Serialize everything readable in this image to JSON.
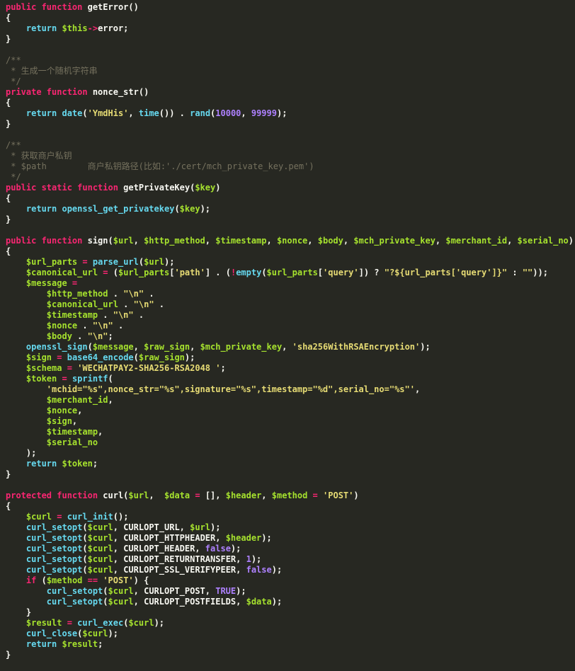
{
  "colors": {
    "background": "#272822",
    "keyword": "#f92672",
    "function": "#66d9ef",
    "variable": "#a6e22e",
    "string": "#e6db74",
    "number": "#ae81ff",
    "comment": "#75715e",
    "default": "#f8f8f2"
  },
  "code": {
    "lines": [
      [
        [
          "k",
          "public function "
        ],
        [
          "d",
          "getError()"
        ]
      ],
      [
        [
          "d",
          "{"
        ]
      ],
      [
        [
          "d",
          "    "
        ],
        [
          "f",
          "return "
        ],
        [
          "v",
          "$this"
        ],
        [
          "o",
          "->"
        ],
        [
          "d",
          "error;"
        ]
      ],
      [
        [
          "d",
          "}"
        ]
      ],
      [
        [
          "d",
          ""
        ]
      ],
      [
        [
          "c",
          "/**"
        ]
      ],
      [
        [
          "c",
          " * 生成一个随机字符串"
        ]
      ],
      [
        [
          "c",
          " */"
        ]
      ],
      [
        [
          "k",
          "private function "
        ],
        [
          "d",
          "nonce_str()"
        ]
      ],
      [
        [
          "d",
          "{"
        ]
      ],
      [
        [
          "d",
          "    "
        ],
        [
          "f",
          "return "
        ],
        [
          "f",
          "date"
        ],
        [
          "d",
          "("
        ],
        [
          "s",
          "'YmdHis'"
        ],
        [
          "d",
          ", "
        ],
        [
          "f",
          "time"
        ],
        [
          "d",
          "()) . "
        ],
        [
          "f",
          "rand"
        ],
        [
          "d",
          "("
        ],
        [
          "n",
          "10000"
        ],
        [
          "d",
          ", "
        ],
        [
          "n",
          "99999"
        ],
        [
          "d",
          ");"
        ]
      ],
      [
        [
          "d",
          "}"
        ]
      ],
      [
        [
          "d",
          ""
        ]
      ],
      [
        [
          "c",
          "/**"
        ]
      ],
      [
        [
          "c",
          " * 获取商户私钥"
        ]
      ],
      [
        [
          "c",
          " * $path        商户私钥路径(比如:'./cert/mch_private_key.pem')"
        ]
      ],
      [
        [
          "c",
          " */"
        ]
      ],
      [
        [
          "k",
          "public static function "
        ],
        [
          "d",
          "getPrivateKey("
        ],
        [
          "v",
          "$key"
        ],
        [
          "d",
          ")"
        ]
      ],
      [
        [
          "d",
          "{"
        ]
      ],
      [
        [
          "d",
          "    "
        ],
        [
          "f",
          "return "
        ],
        [
          "f",
          "openssl_get_privatekey"
        ],
        [
          "d",
          "("
        ],
        [
          "v",
          "$key"
        ],
        [
          "d",
          ");"
        ]
      ],
      [
        [
          "d",
          "}"
        ]
      ],
      [
        [
          "d",
          ""
        ]
      ],
      [
        [
          "k",
          "public function "
        ],
        [
          "d",
          "sign("
        ],
        [
          "v",
          "$url"
        ],
        [
          "d",
          ", "
        ],
        [
          "v",
          "$http_method"
        ],
        [
          "d",
          ", "
        ],
        [
          "v",
          "$timestamp"
        ],
        [
          "d",
          ", "
        ],
        [
          "v",
          "$nonce"
        ],
        [
          "d",
          ", "
        ],
        [
          "v",
          "$body"
        ],
        [
          "d",
          ", "
        ],
        [
          "v",
          "$mch_private_key"
        ],
        [
          "d",
          ", "
        ],
        [
          "v",
          "$merchant_id"
        ],
        [
          "d",
          ", "
        ],
        [
          "v",
          "$serial_no"
        ],
        [
          "d",
          ")"
        ]
      ],
      [
        [
          "d",
          "{"
        ]
      ],
      [
        [
          "d",
          "    "
        ],
        [
          "v",
          "$url_parts"
        ],
        [
          "o",
          " = "
        ],
        [
          "f",
          "parse_url"
        ],
        [
          "d",
          "("
        ],
        [
          "v",
          "$url"
        ],
        [
          "d",
          ");"
        ]
      ],
      [
        [
          "d",
          "    "
        ],
        [
          "v",
          "$canonical_url"
        ],
        [
          "o",
          " = "
        ],
        [
          "d",
          "("
        ],
        [
          "v",
          "$url_parts"
        ],
        [
          "d",
          "["
        ],
        [
          "s",
          "'path'"
        ],
        [
          "d",
          "] . ("
        ],
        [
          "o",
          "!"
        ],
        [
          "f",
          "empty"
        ],
        [
          "d",
          "("
        ],
        [
          "v",
          "$url_parts"
        ],
        [
          "d",
          "["
        ],
        [
          "s",
          "'query'"
        ],
        [
          "d",
          "]) ? "
        ],
        [
          "s",
          "\"?${url_parts['query']}\""
        ],
        [
          "d",
          " : "
        ],
        [
          "s",
          "\"\""
        ],
        [
          "d",
          "));"
        ]
      ],
      [
        [
          "d",
          "    "
        ],
        [
          "v",
          "$message"
        ],
        [
          "o",
          " ="
        ]
      ],
      [
        [
          "d",
          "        "
        ],
        [
          "v",
          "$http_method"
        ],
        [
          "d",
          " . "
        ],
        [
          "s",
          "\"\\n\""
        ],
        [
          "d",
          " ."
        ]
      ],
      [
        [
          "d",
          "        "
        ],
        [
          "v",
          "$canonical_url"
        ],
        [
          "d",
          " . "
        ],
        [
          "s",
          "\"\\n\""
        ],
        [
          "d",
          " ."
        ]
      ],
      [
        [
          "d",
          "        "
        ],
        [
          "v",
          "$timestamp"
        ],
        [
          "d",
          " . "
        ],
        [
          "s",
          "\"\\n\""
        ],
        [
          "d",
          " ."
        ]
      ],
      [
        [
          "d",
          "        "
        ],
        [
          "v",
          "$nonce"
        ],
        [
          "d",
          " . "
        ],
        [
          "s",
          "\"\\n\""
        ],
        [
          "d",
          " ."
        ]
      ],
      [
        [
          "d",
          "        "
        ],
        [
          "v",
          "$body"
        ],
        [
          "d",
          " . "
        ],
        [
          "s",
          "\"\\n\""
        ],
        [
          "d",
          ";"
        ]
      ],
      [
        [
          "d",
          "    "
        ],
        [
          "f",
          "openssl_sign"
        ],
        [
          "d",
          "("
        ],
        [
          "v",
          "$message"
        ],
        [
          "d",
          ", "
        ],
        [
          "v",
          "$raw_sign"
        ],
        [
          "d",
          ", "
        ],
        [
          "v",
          "$mch_private_key"
        ],
        [
          "d",
          ", "
        ],
        [
          "s",
          "'sha256WithRSAEncryption'"
        ],
        [
          "d",
          ");"
        ]
      ],
      [
        [
          "d",
          "    "
        ],
        [
          "v",
          "$sign"
        ],
        [
          "o",
          " = "
        ],
        [
          "f",
          "base64_encode"
        ],
        [
          "d",
          "("
        ],
        [
          "v",
          "$raw_sign"
        ],
        [
          "d",
          ");"
        ]
      ],
      [
        [
          "d",
          "    "
        ],
        [
          "v",
          "$schema"
        ],
        [
          "o",
          " = "
        ],
        [
          "s",
          "'WECHATPAY2-SHA256-RSA2048 '"
        ],
        [
          "d",
          ";"
        ]
      ],
      [
        [
          "d",
          "    "
        ],
        [
          "v",
          "$token"
        ],
        [
          "o",
          " = "
        ],
        [
          "f",
          "sprintf"
        ],
        [
          "d",
          "("
        ]
      ],
      [
        [
          "d",
          "        "
        ],
        [
          "s",
          "'mchid=\"%s\",nonce_str=\"%s\",signature=\"%s\",timestamp=\"%d\",serial_no=\"%s\"'"
        ],
        [
          "d",
          ","
        ]
      ],
      [
        [
          "d",
          "        "
        ],
        [
          "v",
          "$merchant_id"
        ],
        [
          "d",
          ","
        ]
      ],
      [
        [
          "d",
          "        "
        ],
        [
          "v",
          "$nonce"
        ],
        [
          "d",
          ","
        ]
      ],
      [
        [
          "d",
          "        "
        ],
        [
          "v",
          "$sign"
        ],
        [
          "d",
          ","
        ]
      ],
      [
        [
          "d",
          "        "
        ],
        [
          "v",
          "$timestamp"
        ],
        [
          "d",
          ","
        ]
      ],
      [
        [
          "d",
          "        "
        ],
        [
          "v",
          "$serial_no"
        ]
      ],
      [
        [
          "d",
          "    );"
        ]
      ],
      [
        [
          "d",
          "    "
        ],
        [
          "f",
          "return "
        ],
        [
          "v",
          "$token"
        ],
        [
          "d",
          ";"
        ]
      ],
      [
        [
          "d",
          "}"
        ]
      ],
      [
        [
          "d",
          ""
        ]
      ],
      [
        [
          "k",
          "protected function "
        ],
        [
          "d",
          "curl("
        ],
        [
          "v",
          "$url"
        ],
        [
          "d",
          ",  "
        ],
        [
          "v",
          "$data"
        ],
        [
          "o",
          " = "
        ],
        [
          "d",
          "[], "
        ],
        [
          "v",
          "$header"
        ],
        [
          "d",
          ", "
        ],
        [
          "v",
          "$method"
        ],
        [
          "o",
          " = "
        ],
        [
          "s",
          "'POST'"
        ],
        [
          "d",
          ")"
        ]
      ],
      [
        [
          "d",
          "{"
        ]
      ],
      [
        [
          "d",
          "    "
        ],
        [
          "v",
          "$curl"
        ],
        [
          "o",
          " = "
        ],
        [
          "f",
          "curl_init"
        ],
        [
          "d",
          "();"
        ]
      ],
      [
        [
          "d",
          "    "
        ],
        [
          "f",
          "curl_setopt"
        ],
        [
          "d",
          "("
        ],
        [
          "v",
          "$curl"
        ],
        [
          "d",
          ", CURLOPT_URL, "
        ],
        [
          "v",
          "$url"
        ],
        [
          "d",
          ");"
        ]
      ],
      [
        [
          "d",
          "    "
        ],
        [
          "f",
          "curl_setopt"
        ],
        [
          "d",
          "("
        ],
        [
          "v",
          "$curl"
        ],
        [
          "d",
          ", CURLOPT_HTTPHEADER, "
        ],
        [
          "v",
          "$header"
        ],
        [
          "d",
          ");"
        ]
      ],
      [
        [
          "d",
          "    "
        ],
        [
          "f",
          "curl_setopt"
        ],
        [
          "d",
          "("
        ],
        [
          "v",
          "$curl"
        ],
        [
          "d",
          ", CURLOPT_HEADER, "
        ],
        [
          "n",
          "false"
        ],
        [
          "d",
          ");"
        ]
      ],
      [
        [
          "d",
          "    "
        ],
        [
          "f",
          "curl_setopt"
        ],
        [
          "d",
          "("
        ],
        [
          "v",
          "$curl"
        ],
        [
          "d",
          ", CURLOPT_RETURNTRANSFER, "
        ],
        [
          "n",
          "1"
        ],
        [
          "d",
          ");"
        ]
      ],
      [
        [
          "d",
          "    "
        ],
        [
          "f",
          "curl_setopt"
        ],
        [
          "d",
          "("
        ],
        [
          "v",
          "$curl"
        ],
        [
          "d",
          ", CURLOPT_SSL_VERIFYPEER, "
        ],
        [
          "n",
          "false"
        ],
        [
          "d",
          ");"
        ]
      ],
      [
        [
          "d",
          "    "
        ],
        [
          "k",
          "if "
        ],
        [
          "d",
          "("
        ],
        [
          "v",
          "$method"
        ],
        [
          "o",
          " == "
        ],
        [
          "s",
          "'POST'"
        ],
        [
          "d",
          ") {"
        ]
      ],
      [
        [
          "d",
          "        "
        ],
        [
          "f",
          "curl_setopt"
        ],
        [
          "d",
          "("
        ],
        [
          "v",
          "$curl"
        ],
        [
          "d",
          ", CURLOPT_POST, "
        ],
        [
          "n",
          "TRUE"
        ],
        [
          "d",
          ");"
        ]
      ],
      [
        [
          "d",
          "        "
        ],
        [
          "f",
          "curl_setopt"
        ],
        [
          "d",
          "("
        ],
        [
          "v",
          "$curl"
        ],
        [
          "d",
          ", CURLOPT_POSTFIELDS, "
        ],
        [
          "v",
          "$data"
        ],
        [
          "d",
          ");"
        ]
      ],
      [
        [
          "d",
          "    }"
        ]
      ],
      [
        [
          "d",
          "    "
        ],
        [
          "v",
          "$result"
        ],
        [
          "o",
          " = "
        ],
        [
          "f",
          "curl_exec"
        ],
        [
          "d",
          "("
        ],
        [
          "v",
          "$curl"
        ],
        [
          "d",
          ");"
        ]
      ],
      [
        [
          "d",
          "    "
        ],
        [
          "f",
          "curl_close"
        ],
        [
          "d",
          "("
        ],
        [
          "v",
          "$curl"
        ],
        [
          "d",
          ");"
        ]
      ],
      [
        [
          "d",
          "    "
        ],
        [
          "f",
          "return "
        ],
        [
          "v",
          "$result"
        ],
        [
          "d",
          ";"
        ]
      ],
      [
        [
          "d",
          "}"
        ]
      ]
    ]
  }
}
